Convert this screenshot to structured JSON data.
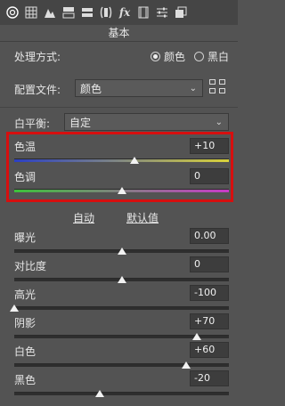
{
  "toolbar": {
    "icons": [
      "aperture-icon",
      "grid-icon",
      "mountains-icon",
      "split-panel-icon",
      "columns-icon",
      "lens-icon",
      "fx-icon",
      "film-icon",
      "sliders-icon",
      "presets-icon"
    ]
  },
  "section": {
    "title": "基本"
  },
  "process": {
    "label": "处理方式:",
    "option_color": "颜色",
    "option_bw": "黑白",
    "selected": "颜色"
  },
  "profile": {
    "label": "配置文件:",
    "value": "颜色"
  },
  "white_balance": {
    "label": "白平衡:",
    "value": "自定"
  },
  "temperature": {
    "label": "色温",
    "value": "+10",
    "level": 0.56
  },
  "tint": {
    "label": "色调",
    "value": "0",
    "level": 0.5
  },
  "tone_links": {
    "auto": "自动",
    "default": "默认值"
  },
  "exposure": {
    "label": "曝光",
    "value": "0.00",
    "level": 0.5
  },
  "contrast": {
    "label": "对比度",
    "value": "0",
    "level": 0.5
  },
  "highlights": {
    "label": "高光",
    "value": "-100",
    "level": 0.0
  },
  "shadows": {
    "label": "阴影",
    "value": "+70",
    "level": 0.85
  },
  "whites": {
    "label": "白色",
    "value": "+60",
    "level": 0.8
  },
  "blacks": {
    "label": "黑色",
    "value": "-20",
    "level": 0.4
  },
  "colors": {
    "highlight_box": "#d60f0f",
    "temp_left": "#2b3fc4",
    "temp_right": "#d9d23a",
    "tint_left": "#3cc23a",
    "tint_right": "#c83ac8"
  }
}
